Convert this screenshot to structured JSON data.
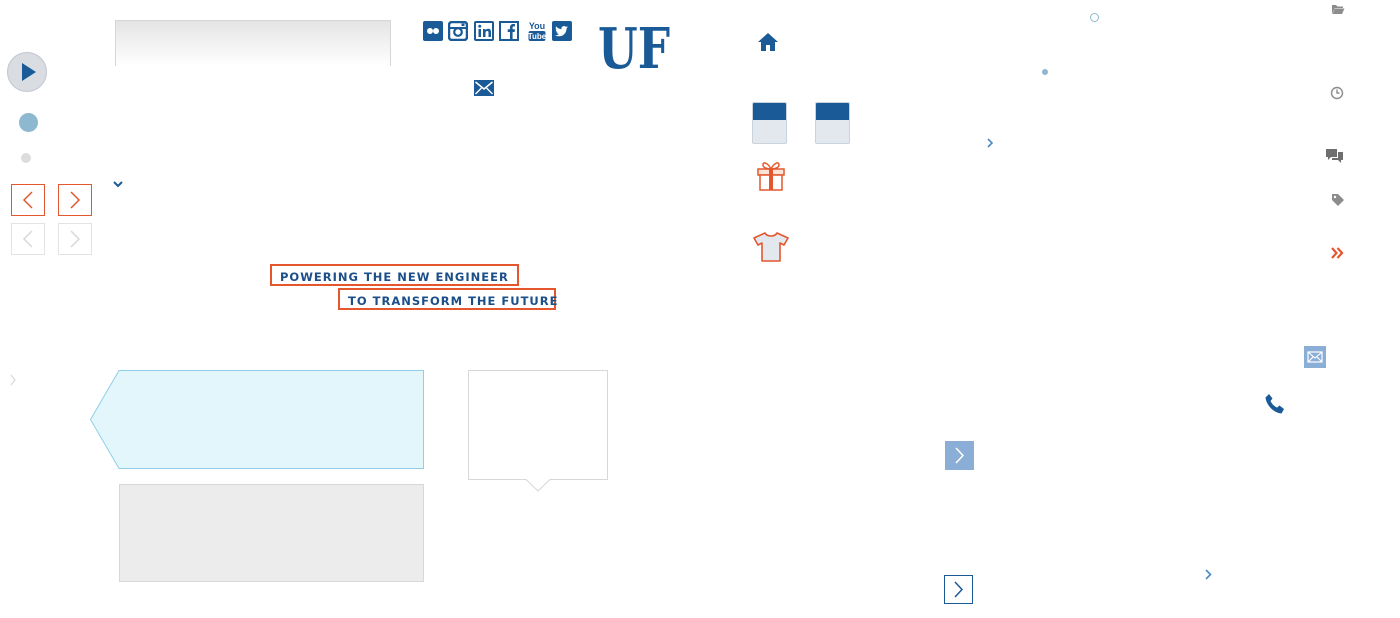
{
  "search": {
    "placeholder": ""
  },
  "social": [
    "flickr-icon",
    "instagram-icon",
    "linkedin-icon",
    "facebook-icon",
    "youtube-icon",
    "twitter-icon"
  ],
  "social_youtube_text": [
    "You",
    "Tube"
  ],
  "brand": {
    "logo_text": "UF",
    "color": "#1a5a96",
    "accent": "#e4572e"
  },
  "hero": {
    "line1": "POWERING THE NEW ENGINEER",
    "line2": "TO TRANSFORM THE FUTURE"
  },
  "icons": {
    "home": "home-icon",
    "calendar": "calendar-icon",
    "gift": "gift-icon",
    "tshirt": "tshirt-icon",
    "folder": "folder-icon",
    "clock": "clock-icon",
    "comments": "comments-icon",
    "tag": "tag-icon",
    "double-chevron": "double-chevron-icon",
    "mail": "mail-icon",
    "phone": "phone-icon"
  },
  "colors": {
    "blue": "#1a5a96",
    "orange": "#e4572e",
    "light_blue": "#8db8cf",
    "callout_bg": "#e3f6fc"
  }
}
